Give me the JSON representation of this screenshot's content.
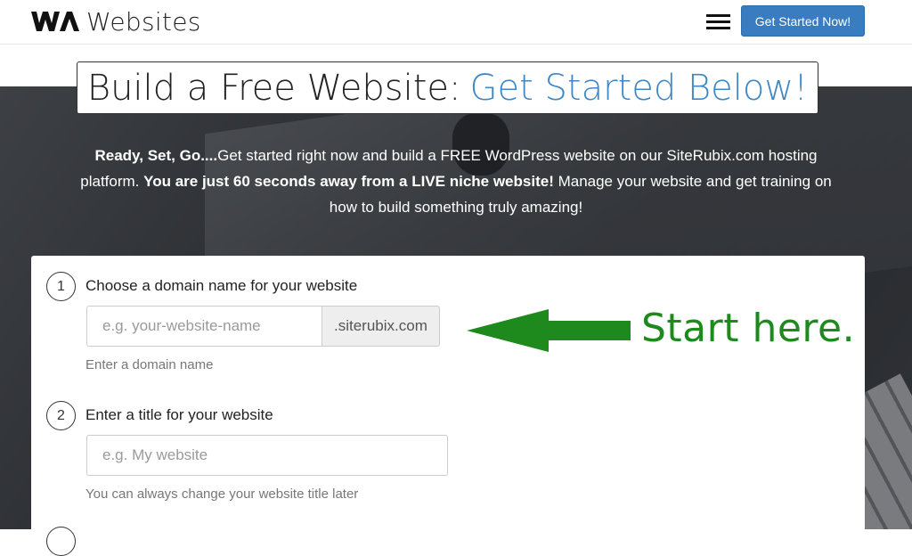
{
  "header": {
    "logo_text": "Websites",
    "logo_mark_icon": "wa-logo-icon",
    "menu_icon": "hamburger-menu-icon",
    "cta_label": "Get Started Now!",
    "cta_color": "#3a7cc0"
  },
  "hero": {
    "title_main": "Build a Free Website:",
    "title_accent": "Get Started Below!",
    "accent_color": "#3f88c5",
    "intro": {
      "part1_bold": "Ready, Set, Go....",
      "part2": "Get started right now and build a FREE WordPress website on our SiteRubix.com hosting platform. ",
      "part3_bold": "You are just 60 seconds away from a LIVE niche website!",
      "part4": " Manage your website and get training on how to build something truly amazing!"
    }
  },
  "form": {
    "step1": {
      "number": "1",
      "label": "Choose a domain name for your website",
      "placeholder": "e.g. your-website-name",
      "value": "",
      "suffix": ".siterubix.com",
      "hint": "Enter a domain name"
    },
    "step2": {
      "number": "2",
      "label": "Enter a title for your website",
      "placeholder": "e.g. My website",
      "value": "",
      "hint": "You can always change your website title later"
    }
  },
  "annotation": {
    "text": "Start here.",
    "color": "#1e8a1e",
    "arrow_icon": "left-arrow-icon"
  }
}
